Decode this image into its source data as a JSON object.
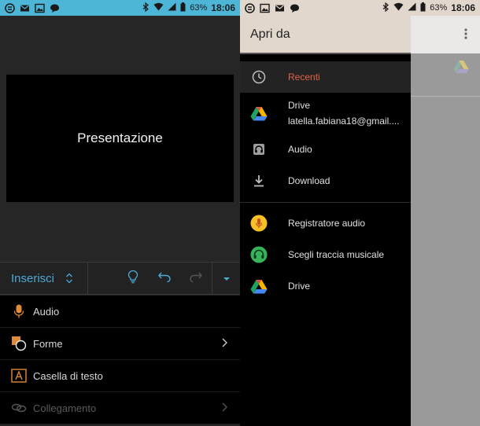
{
  "status_left": {
    "battery": "63%",
    "time": "18:06"
  },
  "status_right": {
    "battery": "63%",
    "time": "18:06"
  },
  "slide": {
    "title": "Presentazione"
  },
  "toolbar": {
    "insert_label": "Inserisci"
  },
  "menu": {
    "items": [
      {
        "label": "Audio"
      },
      {
        "label": "Forme"
      },
      {
        "label": "Casella di testo"
      },
      {
        "label": "Collegamento"
      }
    ]
  },
  "drawer": {
    "title": "Apri da",
    "recent": "Recenti",
    "drive_label": "Drive",
    "drive_account": "latella.fabiana18@gmail....",
    "audio": "Audio",
    "download": "Download",
    "recorder": "Registratore audio",
    "music": "Scegli traccia musicale",
    "drive2": "Drive"
  },
  "colors": {
    "left_status": "#4db6d6",
    "right_status": "#e2d7cd",
    "accent_blue": "#4ba9d6",
    "recent_accent": "#e0624a"
  }
}
